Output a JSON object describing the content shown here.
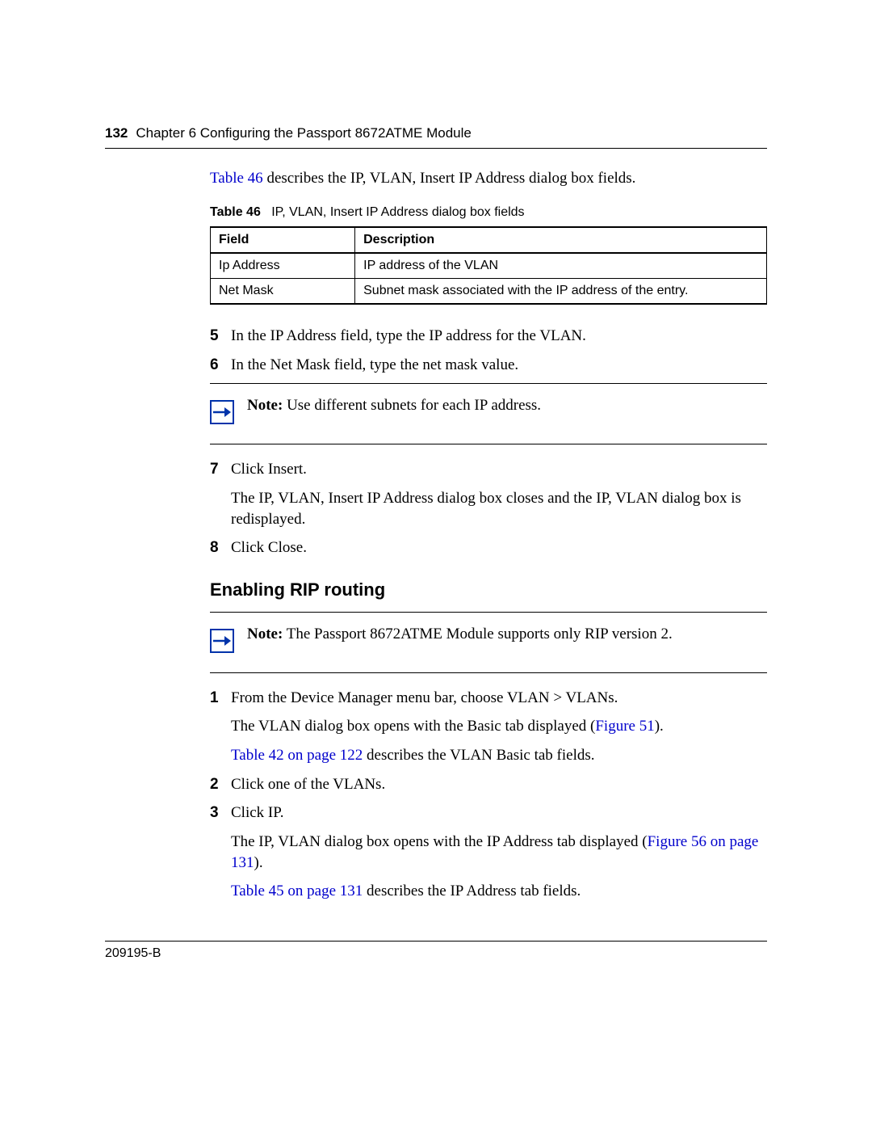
{
  "header": {
    "page_number": "132",
    "chapter": "Chapter 6  Configuring the Passport 8672ATME Module"
  },
  "intro": {
    "link": "Table 46",
    "rest": " describes the IP, VLAN, Insert IP Address dialog box fields."
  },
  "table46": {
    "label": "Table 46",
    "title": "IP, VLAN, Insert IP Address dialog box fields",
    "headers": {
      "field": "Field",
      "description": "Description"
    },
    "rows": [
      {
        "field": "Ip Address",
        "description": "IP address of the VLAN"
      },
      {
        "field": "Net Mask",
        "description": "Subnet mask associated with the IP address of the entry."
      }
    ]
  },
  "steps_a": {
    "s5": {
      "num": "5",
      "text": "In the IP Address field, type the IP address for the VLAN."
    },
    "s6": {
      "num": "6",
      "text": "In the Net Mask field, type the net mask value."
    },
    "s7": {
      "num": "7",
      "text": "Click Insert.",
      "para2": "The IP, VLAN, Insert IP Address dialog box closes and the IP, VLAN dialog box is redisplayed."
    },
    "s8": {
      "num": "8",
      "text": "Click Close."
    }
  },
  "note1": {
    "label": "Note:",
    "text": " Use different subnets for each IP address."
  },
  "section_heading": "Enabling RIP routing",
  "note2": {
    "label": "Note:",
    "text": " The Passport 8672ATME Module supports only RIP version 2."
  },
  "steps_b": {
    "s1": {
      "num": "1",
      "text": "From the Device Manager menu bar, choose VLAN > VLANs.",
      "p2_a": "The VLAN dialog box opens with the Basic tab displayed (",
      "p2_link": "Figure 51",
      "p2_b": ").",
      "p3_link": "Table 42 on page 122",
      "p3_b": " describes the VLAN Basic tab fields."
    },
    "s2": {
      "num": "2",
      "text": "Click one of the VLANs."
    },
    "s3": {
      "num": "3",
      "text": "Click IP.",
      "p2_a": "The IP, VLAN dialog box opens with the IP Address tab displayed (",
      "p2_link": "Figure 56 on page 131",
      "p2_b": ").",
      "p3_link": "Table 45 on page 131",
      "p3_b": " describes the IP Address tab fields."
    }
  },
  "footer": {
    "docnum": "209195-B"
  }
}
